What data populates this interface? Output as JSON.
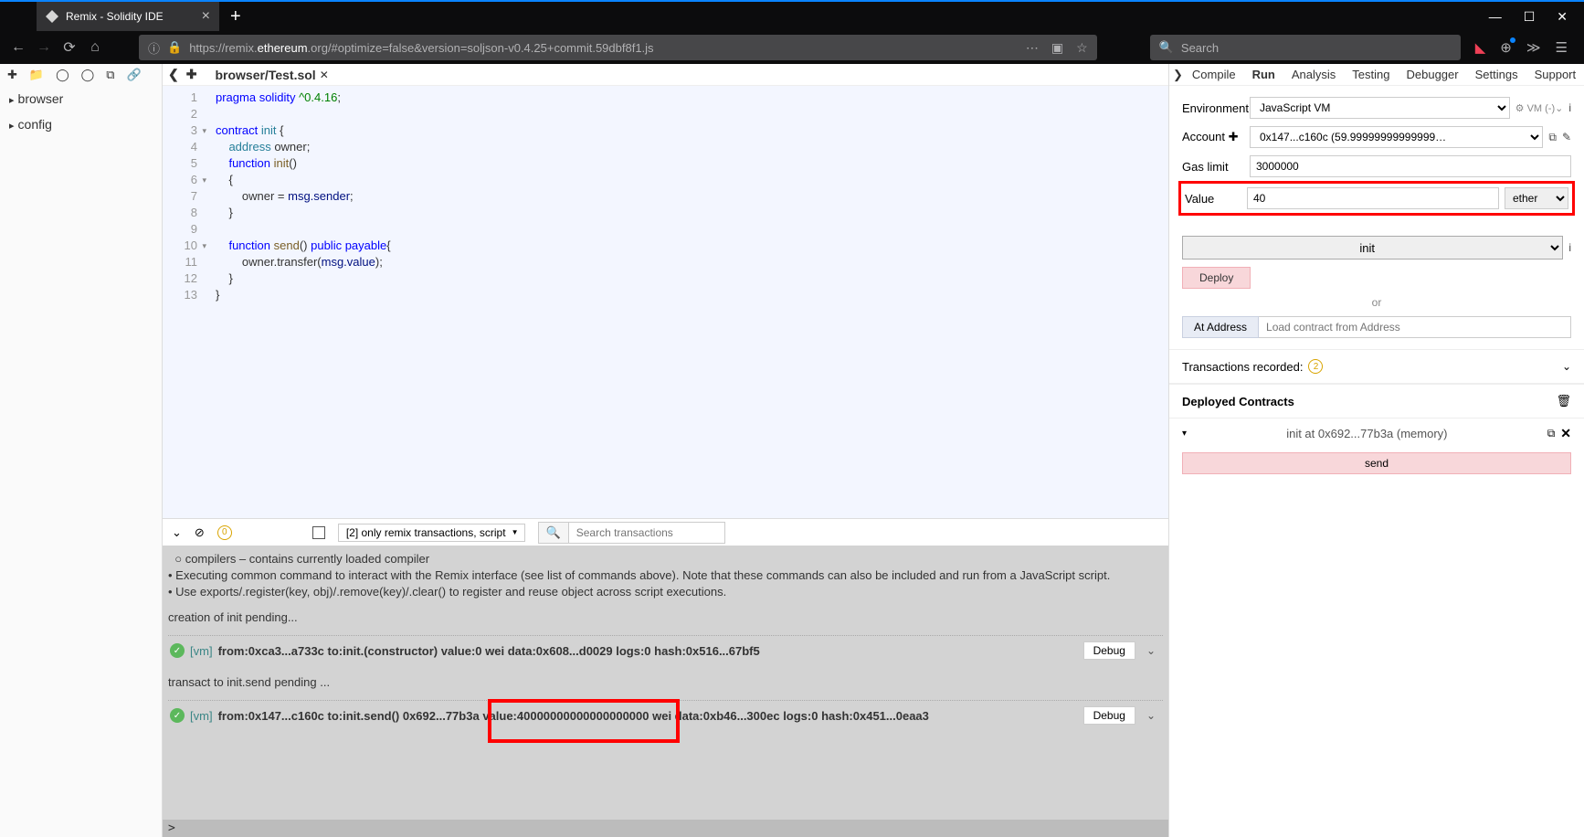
{
  "browser": {
    "tab_title": "Remix - Solidity IDE",
    "url_prefix": "https://remix.",
    "url_domain": "ethereum",
    "url_suffix": ".org/#optimize=false&version=soljson-v0.4.25+commit.59dbf8f1.js",
    "search_placeholder": "Search"
  },
  "sidebar": {
    "items": [
      "browser",
      "config"
    ]
  },
  "file_tab": "browser/Test.sol",
  "code": {
    "lines": [
      "pragma solidity ^0.4.16;",
      "",
      "contract init {",
      "    address owner;",
      "    function init()",
      "    {",
      "        owner = msg.sender;",
      "    }",
      "",
      "    function send() public payable{",
      "        owner.transfer(msg.value);",
      "    }",
      "}"
    ]
  },
  "terminal_bar": {
    "badge": "0",
    "dropdown": "[2] only remix transactions, script",
    "search_placeholder": "Search transactions"
  },
  "terminal": {
    "intro": [
      "  ○ compilers – contains currently loaded compiler",
      "• Executing common command to interact with the Remix interface (see list of commands above). Note that these commands can also be included and run from a JavaScript script.",
      "• Use exports/.register(key, obj)/.remove(key)/.clear() to register and reuse object across script executions."
    ],
    "pending1": "creation of init pending...",
    "tx1": {
      "vm": "[vm]",
      "text_a": "from:0xca3...a733c to:init.(constructor) value:0 wei data:0x608...d0029 logs:0 hash:0x516...67bf5",
      "debug": "Debug"
    },
    "pending2": "transact to init.send pending ...",
    "tx2": {
      "vm": "[vm]",
      "text_a": "from:0x147...c160c to:init.send() 0x692...77b3a ",
      "text_b": "value:40000000000000000000 wei",
      "text_c": " data:0xb46...300ec logs:0 hash:0x451...0eaa3",
      "debug": "Debug"
    }
  },
  "right": {
    "tabs": [
      "Compile",
      "Run",
      "Analysis",
      "Testing",
      "Debugger",
      "Settings",
      "Support"
    ],
    "active_tab": "Run",
    "env_label": "Environment",
    "env_value": "JavaScript VM",
    "env_vm_tag": "VM (-)",
    "account_label": "Account",
    "account_value": "0x147...c160c (59.99999999999999…",
    "gas_label": "Gas limit",
    "gas_value": "3000000",
    "value_label": "Value",
    "value_value": "40",
    "value_unit": "ether",
    "contract_name": "init",
    "deploy": "Deploy",
    "or": "or",
    "at_address": "At Address",
    "at_address_placeholder": "Load contract from Address",
    "tx_recorded_label": "Transactions recorded:",
    "tx_recorded_count": "2",
    "deployed_label": "Deployed Contracts",
    "deployed_instance": "init at 0x692...77b3a (memory)",
    "send_btn": "send"
  }
}
